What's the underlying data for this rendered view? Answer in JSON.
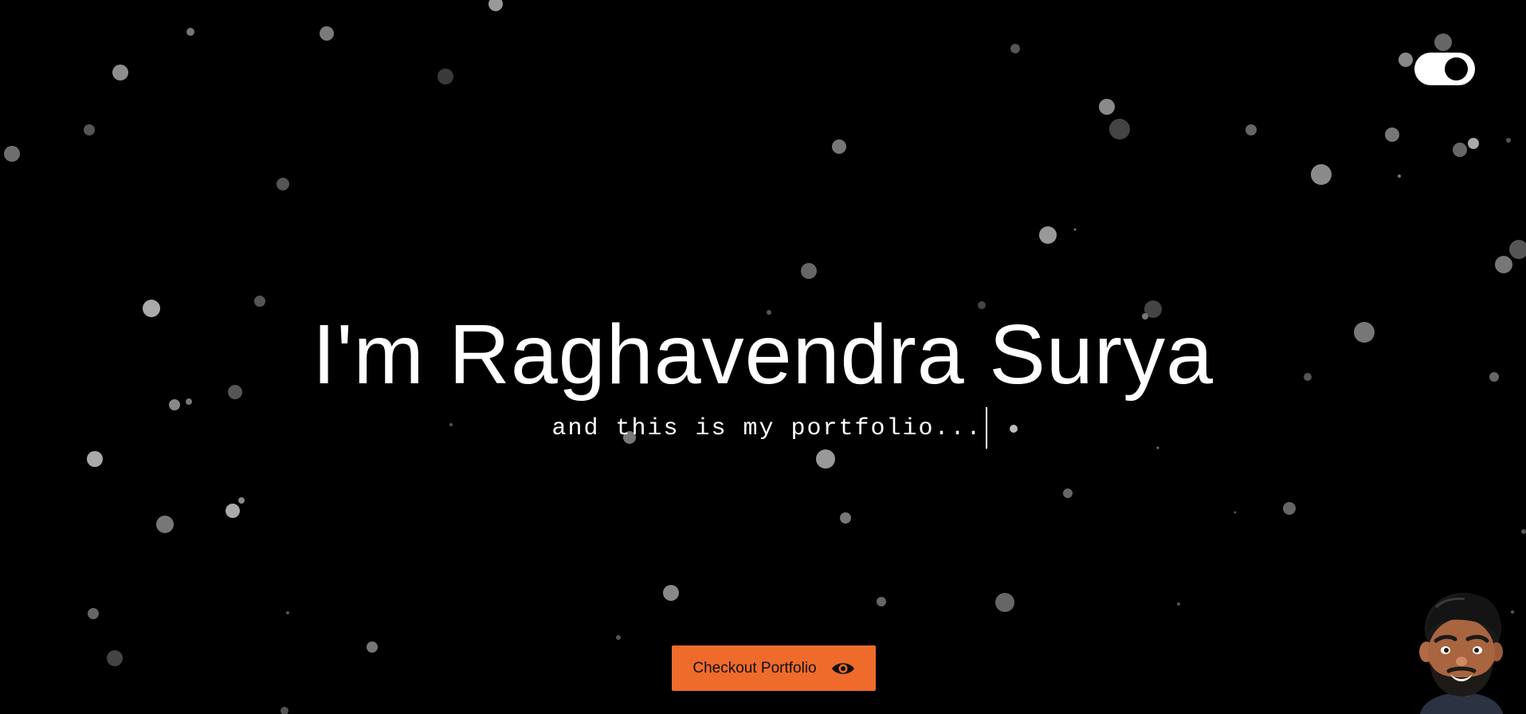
{
  "hero": {
    "title": "I'm Raghavendra Surya",
    "subtitle": "and this is my portfolio..."
  },
  "cta": {
    "label": "Checkout Portfolio",
    "icon": "eye-icon"
  },
  "theme_toggle": {
    "icon": "toggle-switch",
    "state": "on"
  },
  "avatar": {
    "icon": "memoji-avatar"
  },
  "colors": {
    "background": "#000000",
    "text": "#ffffff",
    "accent": "#ef6b2c",
    "particle": "#8a8a8a"
  }
}
